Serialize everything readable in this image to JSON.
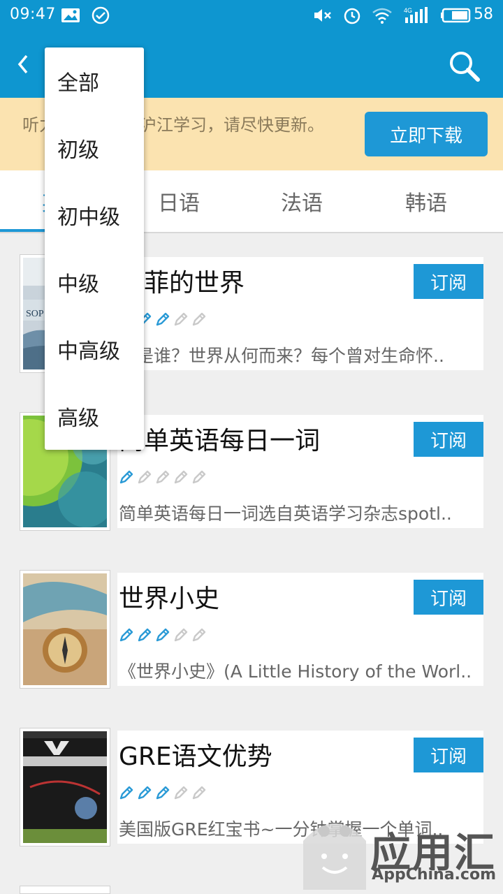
{
  "status_bar": {
    "time": "09:47",
    "battery": "58",
    "network": "4G"
  },
  "banner": {
    "text": "听力酷已升级为沪江学习，请尽快更新。",
    "button_label": "立即下载"
  },
  "tabs": [
    {
      "label": "英语"
    },
    {
      "label": "日语"
    },
    {
      "label": "法语"
    },
    {
      "label": "韩语"
    }
  ],
  "dropdown": {
    "items": [
      {
        "label": "全部"
      },
      {
        "label": "初级"
      },
      {
        "label": "初中级"
      },
      {
        "label": "中级"
      },
      {
        "label": "中高级"
      },
      {
        "label": "高级"
      }
    ]
  },
  "items": [
    {
      "title": "苏菲的世界",
      "level": 3,
      "desc": "我是谁？世界从何而来？每个曾对生命怀..",
      "subscribe": "订阅"
    },
    {
      "title": "简单英语每日一词",
      "level": 1,
      "desc": "简单英语每日一词选自英语学习杂志spotl..",
      "subscribe": "订阅"
    },
    {
      "title": "世界小史",
      "level": 3,
      "desc": "《世界小史》(A Little History of the Worl..",
      "subscribe": "订阅"
    },
    {
      "title": "GRE语文优势",
      "level": 3,
      "desc": "美国版GRE红宝书~一分钟掌握一个单词..",
      "subscribe": "订阅"
    }
  ],
  "watermark": {
    "cn": "应用汇",
    "en": "AppChina.com"
  },
  "colors": {
    "primary": "#0e96d0",
    "accent": "#1e98d6",
    "banner_bg": "#fbe3b0"
  }
}
